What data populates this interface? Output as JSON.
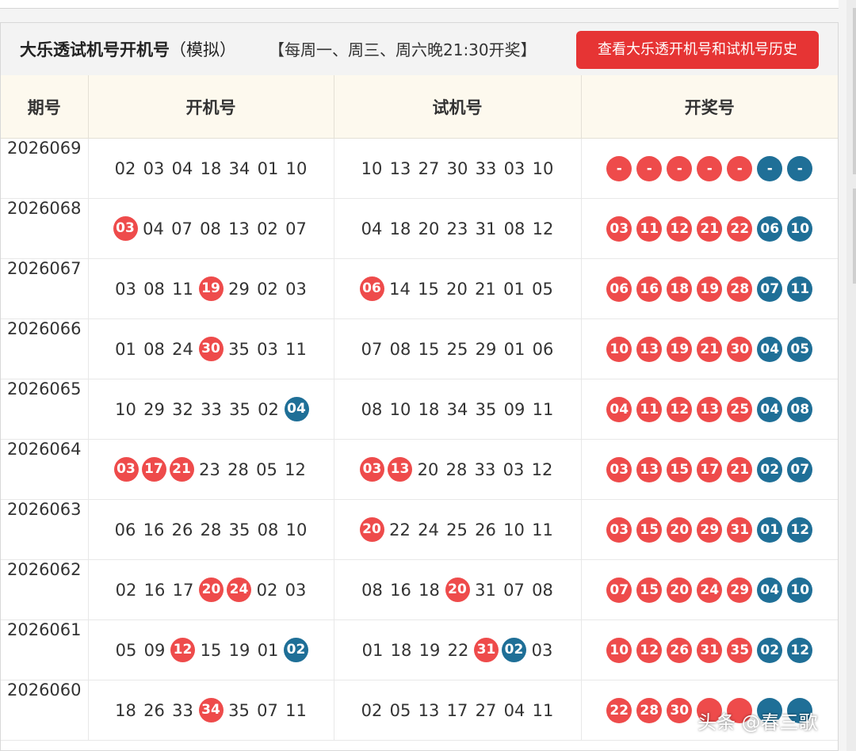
{
  "header": {
    "title_main": "大乐透试机号开机号",
    "title_sub": "（模拟）",
    "schedule": "【每周一、周三、周六晚21:30开奖】",
    "history_button": "查看大乐透开机号和试机号历史"
  },
  "columns": [
    "期号",
    "开机号",
    "试机号",
    "开奖号"
  ],
  "rows": [
    {
      "period": "2026069",
      "open_machine": [
        {
          "n": "02"
        },
        {
          "n": "03"
        },
        {
          "n": "04"
        },
        {
          "n": "18"
        },
        {
          "n": "34"
        },
        {
          "n": "01"
        },
        {
          "n": "10"
        }
      ],
      "test_machine": [
        {
          "n": "10"
        },
        {
          "n": "13"
        },
        {
          "n": "27"
        },
        {
          "n": "30"
        },
        {
          "n": "33"
        },
        {
          "n": "03"
        },
        {
          "n": "10"
        }
      ],
      "draw": [
        "-",
        "-",
        "-",
        "-",
        "-",
        "-",
        "-"
      ]
    },
    {
      "period": "2026068",
      "open_machine": [
        {
          "n": "03",
          "hl": "red"
        },
        {
          "n": "04"
        },
        {
          "n": "07"
        },
        {
          "n": "08"
        },
        {
          "n": "13"
        },
        {
          "n": "02"
        },
        {
          "n": "07"
        }
      ],
      "test_machine": [
        {
          "n": "04"
        },
        {
          "n": "18"
        },
        {
          "n": "20"
        },
        {
          "n": "23"
        },
        {
          "n": "31"
        },
        {
          "n": "08"
        },
        {
          "n": "12"
        }
      ],
      "draw": [
        "03",
        "11",
        "12",
        "21",
        "22",
        "06",
        "10"
      ]
    },
    {
      "period": "2026067",
      "open_machine": [
        {
          "n": "03"
        },
        {
          "n": "08"
        },
        {
          "n": "11"
        },
        {
          "n": "19",
          "hl": "red"
        },
        {
          "n": "29"
        },
        {
          "n": "02"
        },
        {
          "n": "03"
        }
      ],
      "test_machine": [
        {
          "n": "06",
          "hl": "red"
        },
        {
          "n": "14"
        },
        {
          "n": "15"
        },
        {
          "n": "20"
        },
        {
          "n": "21"
        },
        {
          "n": "01"
        },
        {
          "n": "05"
        }
      ],
      "draw": [
        "06",
        "16",
        "18",
        "19",
        "28",
        "07",
        "11"
      ]
    },
    {
      "period": "2026066",
      "open_machine": [
        {
          "n": "01"
        },
        {
          "n": "08"
        },
        {
          "n": "24"
        },
        {
          "n": "30",
          "hl": "red"
        },
        {
          "n": "35"
        },
        {
          "n": "03"
        },
        {
          "n": "11"
        }
      ],
      "test_machine": [
        {
          "n": "07"
        },
        {
          "n": "08"
        },
        {
          "n": "15"
        },
        {
          "n": "25"
        },
        {
          "n": "29"
        },
        {
          "n": "01"
        },
        {
          "n": "06"
        }
      ],
      "draw": [
        "10",
        "13",
        "19",
        "21",
        "30",
        "04",
        "05"
      ]
    },
    {
      "period": "2026065",
      "open_machine": [
        {
          "n": "10"
        },
        {
          "n": "29"
        },
        {
          "n": "32"
        },
        {
          "n": "33"
        },
        {
          "n": "35"
        },
        {
          "n": "02"
        },
        {
          "n": "04",
          "hl": "blue"
        }
      ],
      "test_machine": [
        {
          "n": "08"
        },
        {
          "n": "10"
        },
        {
          "n": "18"
        },
        {
          "n": "34"
        },
        {
          "n": "35"
        },
        {
          "n": "09"
        },
        {
          "n": "11"
        }
      ],
      "draw": [
        "04",
        "11",
        "12",
        "13",
        "25",
        "04",
        "08"
      ]
    },
    {
      "period": "2026064",
      "open_machine": [
        {
          "n": "03",
          "hl": "red"
        },
        {
          "n": "17",
          "hl": "red"
        },
        {
          "n": "21",
          "hl": "red"
        },
        {
          "n": "23"
        },
        {
          "n": "28"
        },
        {
          "n": "05"
        },
        {
          "n": "12"
        }
      ],
      "test_machine": [
        {
          "n": "03",
          "hl": "red"
        },
        {
          "n": "13",
          "hl": "red"
        },
        {
          "n": "20"
        },
        {
          "n": "28"
        },
        {
          "n": "33"
        },
        {
          "n": "03"
        },
        {
          "n": "12"
        }
      ],
      "draw": [
        "03",
        "13",
        "15",
        "17",
        "21",
        "02",
        "07"
      ]
    },
    {
      "period": "2026063",
      "open_machine": [
        {
          "n": "06"
        },
        {
          "n": "16"
        },
        {
          "n": "26"
        },
        {
          "n": "28"
        },
        {
          "n": "35"
        },
        {
          "n": "08"
        },
        {
          "n": "10"
        }
      ],
      "test_machine": [
        {
          "n": "20",
          "hl": "red"
        },
        {
          "n": "22"
        },
        {
          "n": "24"
        },
        {
          "n": "25"
        },
        {
          "n": "26"
        },
        {
          "n": "10"
        },
        {
          "n": "11"
        }
      ],
      "draw": [
        "03",
        "15",
        "20",
        "29",
        "31",
        "01",
        "12"
      ]
    },
    {
      "period": "2026062",
      "open_machine": [
        {
          "n": "02"
        },
        {
          "n": "16"
        },
        {
          "n": "17"
        },
        {
          "n": "20",
          "hl": "red"
        },
        {
          "n": "24",
          "hl": "red"
        },
        {
          "n": "02"
        },
        {
          "n": "03"
        }
      ],
      "test_machine": [
        {
          "n": "08"
        },
        {
          "n": "16"
        },
        {
          "n": "18"
        },
        {
          "n": "20",
          "hl": "red"
        },
        {
          "n": "31"
        },
        {
          "n": "07"
        },
        {
          "n": "08"
        }
      ],
      "draw": [
        "07",
        "15",
        "20",
        "24",
        "29",
        "04",
        "10"
      ]
    },
    {
      "period": "2026061",
      "open_machine": [
        {
          "n": "05"
        },
        {
          "n": "09"
        },
        {
          "n": "12",
          "hl": "red"
        },
        {
          "n": "15"
        },
        {
          "n": "19"
        },
        {
          "n": "01"
        },
        {
          "n": "02",
          "hl": "blue"
        }
      ],
      "test_machine": [
        {
          "n": "01"
        },
        {
          "n": "18"
        },
        {
          "n": "19"
        },
        {
          "n": "22"
        },
        {
          "n": "31",
          "hl": "red"
        },
        {
          "n": "02",
          "hl": "blue"
        },
        {
          "n": "03"
        }
      ],
      "draw": [
        "10",
        "12",
        "26",
        "31",
        "35",
        "02",
        "12"
      ]
    },
    {
      "period": "2026060",
      "open_machine": [
        {
          "n": "18"
        },
        {
          "n": "26"
        },
        {
          "n": "33"
        },
        {
          "n": "34",
          "hl": "red"
        },
        {
          "n": "35"
        },
        {
          "n": "07"
        },
        {
          "n": "11"
        }
      ],
      "test_machine": [
        {
          "n": "02"
        },
        {
          "n": "05"
        },
        {
          "n": "13"
        },
        {
          "n": "17"
        },
        {
          "n": "27"
        },
        {
          "n": "04"
        },
        {
          "n": "11"
        }
      ],
      "draw": [
        "22",
        "28",
        "30",
        "",
        "",
        "",
        ""
      ]
    }
  ],
  "colors": {
    "red_ball": "#ee4b4b",
    "blue_ball": "#1f6f97",
    "button": "#e63434"
  },
  "watermark": "头条 @春三歌"
}
